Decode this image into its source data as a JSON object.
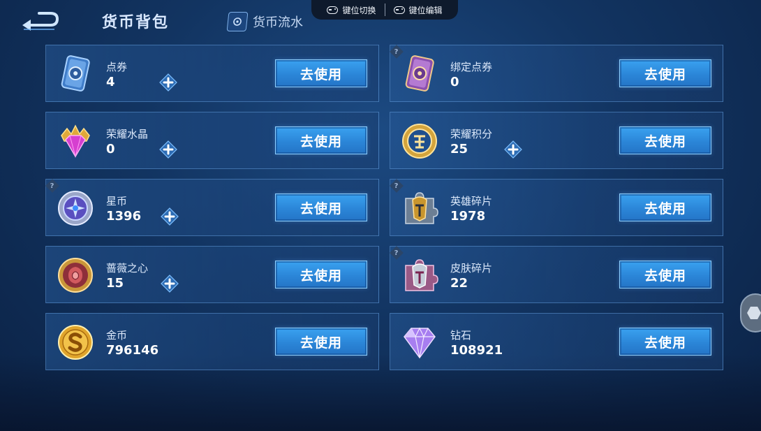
{
  "header": {
    "title": "货币背包",
    "tab_flow_label": "货币流水",
    "keybar": {
      "switch_label": "键位切换",
      "edit_label": "键位编辑"
    }
  },
  "use_button_label": "去使用",
  "help_mark": "?",
  "items": [
    {
      "name": "点券",
      "count": "4",
      "has_plus": true,
      "has_help": false,
      "icon": "coupon-card-blue-icon"
    },
    {
      "name": "绑定点券",
      "count": "0",
      "has_plus": false,
      "has_help": true,
      "icon": "bound-coupon-card-purple-icon"
    },
    {
      "name": "荣耀水晶",
      "count": "0",
      "has_plus": true,
      "has_help": false,
      "icon": "glory-crystal-icon"
    },
    {
      "name": "荣耀积分",
      "count": "25",
      "has_plus": true,
      "has_help": false,
      "icon": "glory-points-coin-icon"
    },
    {
      "name": "星币",
      "count": "1396",
      "has_plus": true,
      "has_help": true,
      "icon": "star-coin-icon"
    },
    {
      "name": "英雄碎片",
      "count": "1978",
      "has_plus": false,
      "has_help": true,
      "icon": "hero-fragment-icon"
    },
    {
      "name": "蔷薇之心",
      "count": "15",
      "has_plus": true,
      "has_help": false,
      "icon": "rose-heart-icon"
    },
    {
      "name": "皮肤碎片",
      "count": "22",
      "has_plus": false,
      "has_help": true,
      "icon": "skin-fragment-icon"
    },
    {
      "name": "金币",
      "count": "796146",
      "has_plus": false,
      "has_help": false,
      "icon": "gold-coin-icon"
    },
    {
      "name": "钻石",
      "count": "108921",
      "has_plus": false,
      "has_help": false,
      "icon": "diamond-icon"
    }
  ],
  "colors": {
    "accent_button": "#2b86d8",
    "background": "#123461",
    "card_border": "#6eaaeb"
  }
}
